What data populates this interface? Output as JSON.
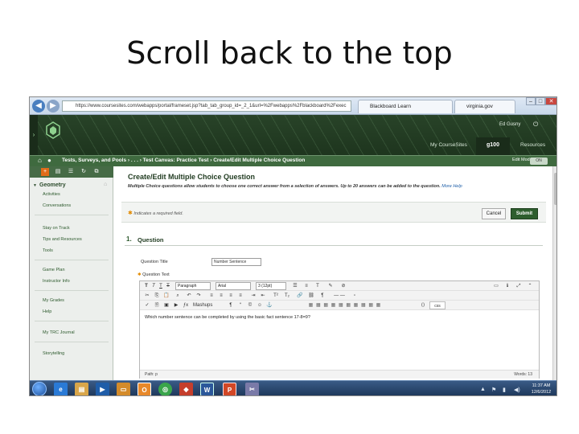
{
  "slide": {
    "title": "Scroll back to the top"
  },
  "browser": {
    "url": "https://www.coursesites.com/webapps/portal/frameset.jsp?tab_tab_group_id=_2_1&url=%2Fwebapps%2Fblackboard%2Fexec",
    "tabs": [
      "Blackboard Learn",
      "virginia.gov"
    ]
  },
  "header": {
    "user": "Ed Gusny",
    "links": [
      "My CourseSites",
      "g100",
      "Resources"
    ],
    "edit_mode_label": "Edit Mode is",
    "edit_mode_value": "ON"
  },
  "breadcrumb": "Tests, Surveys, and Pools ›  . . .  › Test Canvas: Practice Test  › Create/Edit Multiple Choice Question",
  "course_menu": {
    "course_name": "Geometry",
    "items": [
      "Activities",
      "Conversations",
      "Stay on Track",
      "Tips and Resources",
      "Tools",
      "Game Plan",
      "Instructor Info",
      "My Grades",
      "Help",
      "My TRC Journal",
      "Storytelling"
    ]
  },
  "page": {
    "title": "Create/Edit Multiple Choice Question",
    "subtitle": "Multiple Choice questions allow students to choose one correct answer from a selection of answers. Up to 20 answers can be added to the question.",
    "help_link": "More Help",
    "required_note": "Indicates a required field.",
    "cancel_label": "Cancel",
    "submit_label": "Submit",
    "section_number": "1.",
    "section_title": "Question",
    "question_title_label": "Question Title",
    "question_title_value": "Number Sentence",
    "question_text_label": "Question Text",
    "editor": {
      "format_value": "Paragraph",
      "font_value": "Arial",
      "size_value": "3 (12pt)",
      "mashups_label": "Mashups",
      "content": "Which number sentence can be completed by using the basic fact sentence 17-8=9?",
      "path_label": "Path: p",
      "words_label": "Words: 13"
    }
  },
  "taskbar": {
    "time": "11:37 AM",
    "date": "12/6/2012"
  }
}
